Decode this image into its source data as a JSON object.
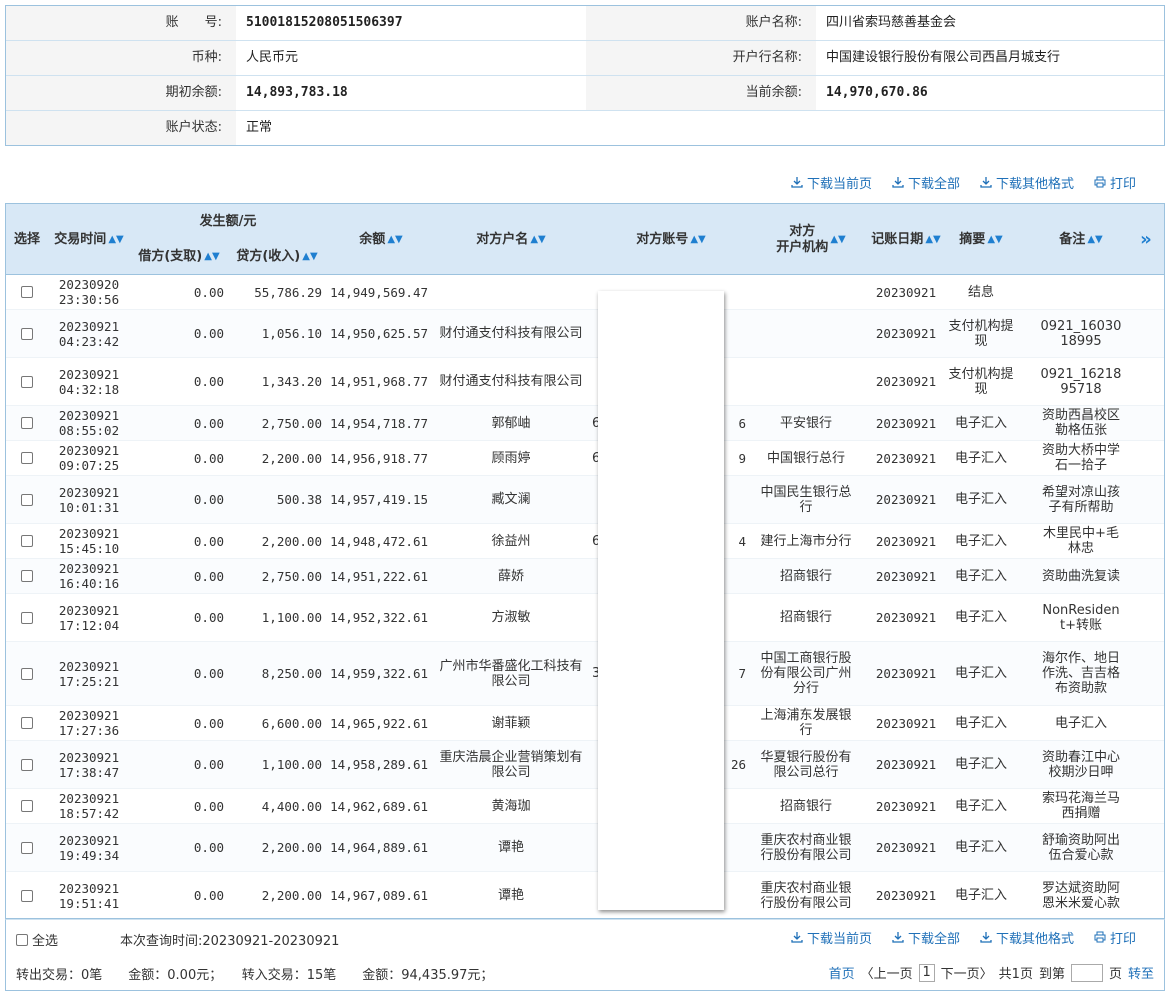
{
  "account": {
    "account_no_label": "账　　号:",
    "account_no": "51001815208051506397",
    "account_name_label": "账户名称:",
    "account_name": "四川省索玛慈善基金会",
    "currency_label": "币种:",
    "currency": "人民币元",
    "bank_label": "开户行名称:",
    "bank": "中国建设银行股份有限公司西昌月城支行",
    "opening_balance_label": "期初余额:",
    "opening_balance": "14,893,783.18",
    "current_balance_label": "当前余额:",
    "current_balance": "14,970,670.86",
    "status_label": "账户状态:",
    "status": "正常"
  },
  "toolbar": {
    "download_page": "下载当前页",
    "download_all": "下载全部",
    "download_other": "下载其他格式",
    "print": "打印"
  },
  "table": {
    "headers": {
      "select": "选择",
      "time": "交易时间",
      "amount_group": "发生额/元",
      "debit": "借方(支取)",
      "credit": "贷方(收入)",
      "balance": "余额",
      "party_name": "对方户名",
      "party_account": "对方账号",
      "party_bank": "对方\n开户机构",
      "post_date": "记账日期",
      "summary": "摘要",
      "remark": "备注",
      "more": "»"
    },
    "rows": [
      {
        "date": "20230920",
        "time": "23:30:56",
        "debit": "0.00",
        "credit": "55,786.29",
        "balance": "14,949,569.47",
        "name": "",
        "acct_l": "",
        "acct_r": "",
        "bank": "",
        "post": "20230921",
        "summary": "结息",
        "remark": ""
      },
      {
        "date": "20230921",
        "time": "04:23:42",
        "debit": "0.00",
        "credit": "1,056.10",
        "balance": "14,950,625.57",
        "name": "财付通支付科技有限公司",
        "acct_l": "",
        "acct_r": "",
        "bank": "",
        "post": "20230921",
        "summary": "支付机构提现",
        "remark": "0921_16030 18995"
      },
      {
        "date": "20230921",
        "time": "04:32:18",
        "debit": "0.00",
        "credit": "1,343.20",
        "balance": "14,951,968.77",
        "name": "财付通支付科技有限公司",
        "acct_l": "",
        "acct_r": "",
        "bank": "",
        "post": "20230921",
        "summary": "支付机构提现",
        "remark": "0921_16218 95718"
      },
      {
        "date": "20230921",
        "time": "08:55:02",
        "debit": "0.00",
        "credit": "2,750.00",
        "balance": "14,954,718.77",
        "name": "郭郁岫",
        "acct_l": "6",
        "acct_r": "6",
        "bank": "平安银行",
        "post": "20230921",
        "summary": "电子汇入",
        "remark": "资助西昌校区勒格伍张"
      },
      {
        "date": "20230921",
        "time": "09:07:25",
        "debit": "0.00",
        "credit": "2,200.00",
        "balance": "14,956,918.77",
        "name": "顾雨婷",
        "acct_l": "6",
        "acct_r": "9",
        "bank": "中国银行总行",
        "post": "20230921",
        "summary": "电子汇入",
        "remark": "资助大桥中学石一拾子"
      },
      {
        "date": "20230921",
        "time": "10:01:31",
        "debit": "0.00",
        "credit": "500.38",
        "balance": "14,957,419.15",
        "name": "臧文澜",
        "acct_l": "",
        "acct_r": "",
        "bank": "中国民生银行总行",
        "post": "20230921",
        "summary": "电子汇入",
        "remark": "希望对凉山孩子有所帮助"
      },
      {
        "date": "20230921",
        "time": "15:45:10",
        "debit": "0.00",
        "credit": "2,200.00",
        "balance": "14,948,472.61",
        "name": "徐益州",
        "acct_l": "6",
        "acct_r": "4",
        "bank": "建行上海市分行",
        "post": "20230921",
        "summary": "电子汇入",
        "remark": "木里民中+毛林忠"
      },
      {
        "date": "20230921",
        "time": "16:40:16",
        "debit": "0.00",
        "credit": "2,750.00",
        "balance": "14,951,222.61",
        "name": "薛娇",
        "acct_l": "",
        "acct_r": "",
        "bank": "招商银行",
        "post": "20230921",
        "summary": "电子汇入",
        "remark": "资助曲洗复读"
      },
      {
        "date": "20230921",
        "time": "17:12:04",
        "debit": "0.00",
        "credit": "1,100.00",
        "balance": "14,952,322.61",
        "name": "方淑敏",
        "acct_l": "",
        "acct_r": "",
        "bank": "招商银行",
        "post": "20230921",
        "summary": "电子汇入",
        "remark": "NonResident+转账"
      },
      {
        "date": "20230921",
        "time": "17:25:21",
        "debit": "0.00",
        "credit": "8,250.00",
        "balance": "14,959,322.61",
        "name": "广州市华番盛化工科技有限公司",
        "acct_l": "3",
        "acct_r": "7",
        "bank": "中国工商银行股份有限公司广州分行",
        "post": "20230921",
        "summary": "电子汇入",
        "remark": "海尔作、地日作洗、吉吉格布资助款"
      },
      {
        "date": "20230921",
        "time": "17:27:36",
        "debit": "0.00",
        "credit": "6,600.00",
        "balance": "14,965,922.61",
        "name": "谢菲颖",
        "acct_l": "",
        "acct_r": "",
        "bank": "上海浦东发展银行",
        "post": "20230921",
        "summary": "电子汇入",
        "remark": "电子汇入"
      },
      {
        "date": "20230921",
        "time": "17:38:47",
        "debit": "0.00",
        "credit": "1,100.00",
        "balance": "14,958,289.61",
        "name": "重庆浩晨企业营销策划有限公司",
        "acct_l": "",
        "acct_r": "26",
        "bank": "华夏银行股份有限公司总行",
        "post": "20230921",
        "summary": "电子汇入",
        "remark": "资助春江中心校期沙日呷"
      },
      {
        "date": "20230921",
        "time": "18:57:42",
        "debit": "0.00",
        "credit": "4,400.00",
        "balance": "14,962,689.61",
        "name": "黄海珈",
        "acct_l": "",
        "acct_r": "",
        "bank": "招商银行",
        "post": "20230921",
        "summary": "电子汇入",
        "remark": "索玛花海兰马西捐赠"
      },
      {
        "date": "20230921",
        "time": "19:49:34",
        "debit": "0.00",
        "credit": "2,200.00",
        "balance": "14,964,889.61",
        "name": "谭艳",
        "acct_l": "",
        "acct_r": "",
        "bank": "重庆农村商业银行股份有限公司",
        "post": "20230921",
        "summary": "电子汇入",
        "remark": "舒瑜资助阿出伍合爱心款"
      },
      {
        "date": "20230921",
        "time": "19:51:41",
        "debit": "0.00",
        "credit": "2,200.00",
        "balance": "14,967,089.61",
        "name": "谭艳",
        "acct_l": "",
        "acct_r": "",
        "bank": "重庆农村商业银行股份有限公司",
        "post": "20230921",
        "summary": "电子汇入",
        "remark": "罗达斌资助阿恩米米爱心款"
      }
    ]
  },
  "footer": {
    "select_all": "全选",
    "query_time": "本次查询时间:20230921-20230921",
    "summary": "转出交易：0笔　　金额：0.00元；　　转入交易：15笔　　金额：94,435.97元；",
    "first_page": "首页",
    "prev_page": "〈上一页",
    "page_value": "1",
    "next_page": "下一页〉",
    "total_pages": "共1页",
    "goto_label": "到第",
    "page_unit": "页",
    "goto_button": "转至"
  },
  "colors": {
    "link": "#1f70b8",
    "header_bg": "#d8e8f6",
    "border": "#9cc2de"
  },
  "icons": [
    "download-icon",
    "print-icon",
    "sort-icon",
    "more-columns-icon",
    "checkbox-icon"
  ]
}
